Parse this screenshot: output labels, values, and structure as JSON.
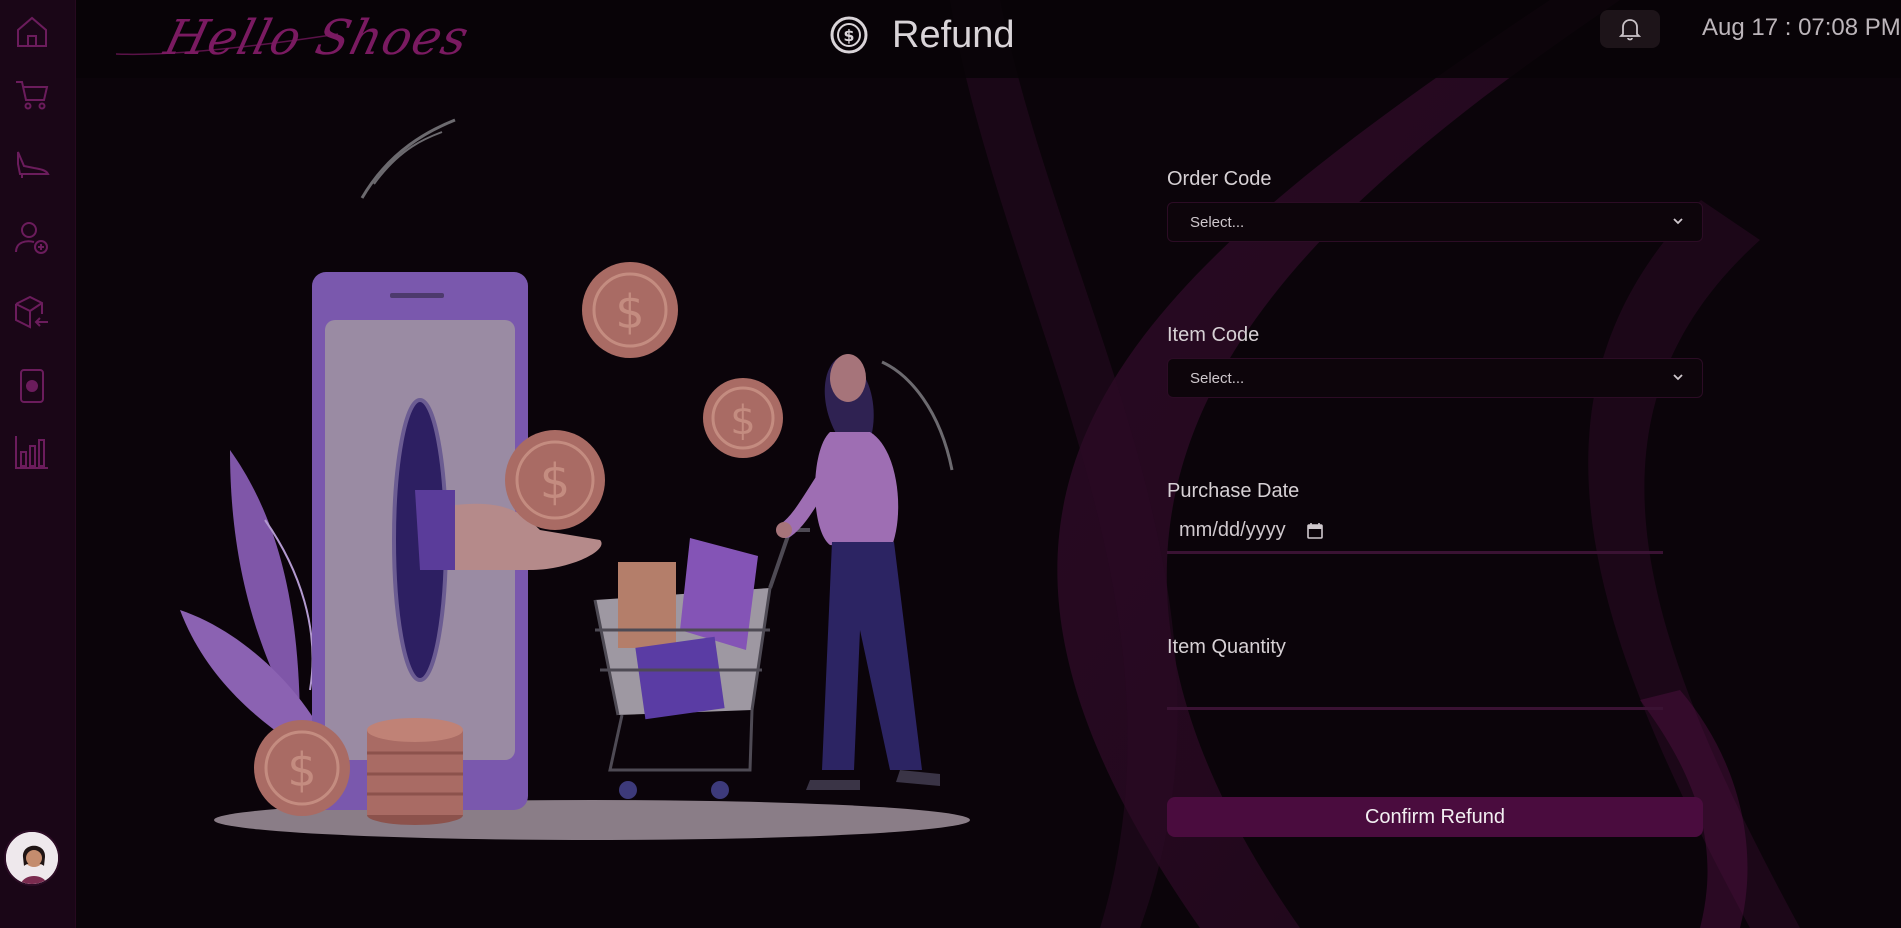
{
  "app": {
    "brand_name": "Hello Shoes"
  },
  "header": {
    "title": "Refund",
    "title_icon": "dollar-circle-icon",
    "notification_icon": "bell-icon",
    "datetime": "Aug 17 : 07:08 PM"
  },
  "sidebar": {
    "items": [
      {
        "icon": "home-icon"
      },
      {
        "icon": "cart-icon"
      },
      {
        "icon": "shoe-icon"
      },
      {
        "icon": "add-user-icon"
      },
      {
        "icon": "box-return-icon"
      },
      {
        "icon": "phone-icon"
      },
      {
        "icon": "bar-chart-icon"
      }
    ],
    "avatar": "user-avatar"
  },
  "form": {
    "order_code": {
      "label": "Order Code",
      "value": "Select..."
    },
    "item_code": {
      "label": "Item Code",
      "value": "Select..."
    },
    "purchase_date": {
      "label": "Purchase Date",
      "placeholder": "mm/dd/yyyy"
    },
    "item_quantity": {
      "label": "Item Quantity",
      "value": ""
    },
    "submit_label": "Confirm Refund"
  },
  "colors": {
    "background": "#0b040a",
    "sidebar": "#1a0617",
    "accent": "#4a0c3e",
    "icon": "#6b1c5c"
  }
}
